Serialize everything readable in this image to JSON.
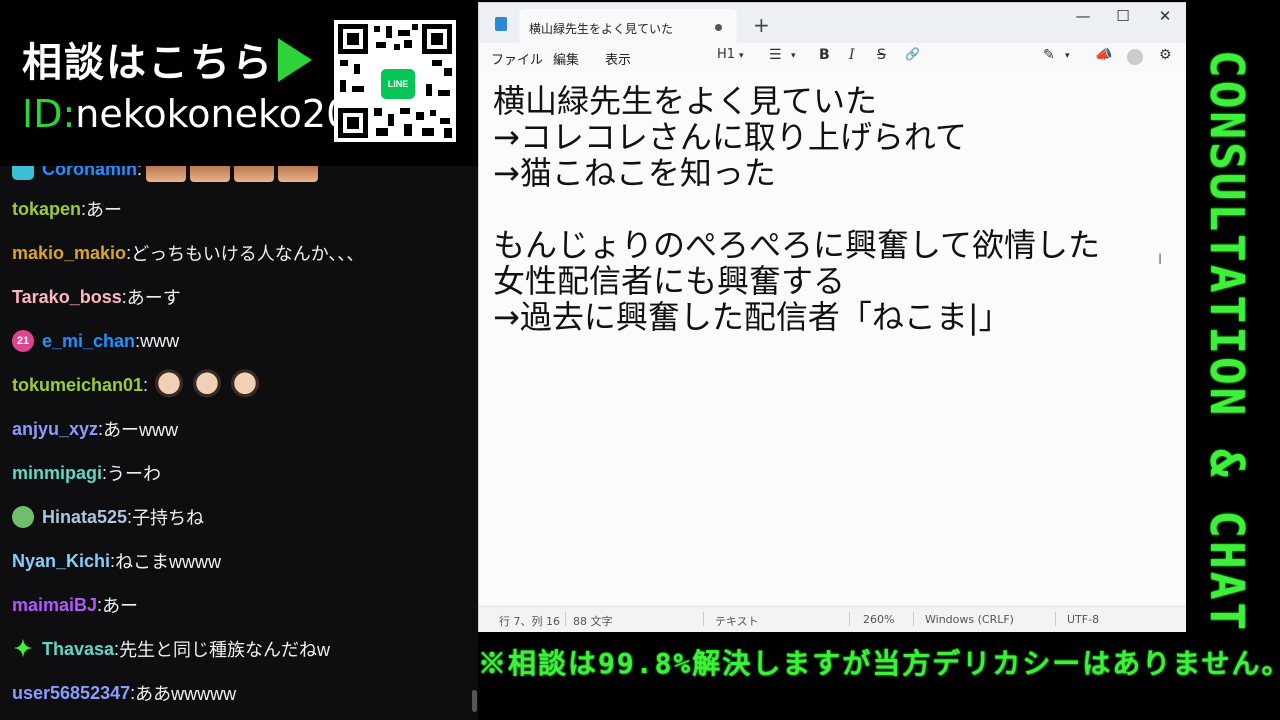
{
  "header": {
    "title": "相談はこちら",
    "id_prefix": "ID:",
    "id_value": "nekokoneko2018",
    "line_logo": "LINE"
  },
  "chat": {
    "messages": [
      {
        "user": "Coronamin",
        "color": "#1e90ff",
        "text": "",
        "badge": "shield",
        "emotes": [
          "brown",
          "brown",
          "brown",
          "brown"
        ]
      },
      {
        "user": "tokapen",
        "color": "#9acd32",
        "text": "あー",
        "badge": "",
        "emotes": []
      },
      {
        "user": "makio_makio",
        "color": "#daa520",
        "text": "どっちもいける人なんか､､､",
        "badge": "",
        "emotes": []
      },
      {
        "user": "Tarako_boss",
        "color": "#ffb6c1",
        "text": "あーす",
        "badge": "",
        "emotes": []
      },
      {
        "user": "e_mi_chan",
        "color": "#1e90ff",
        "text": "www",
        "badge": "21",
        "emotes": []
      },
      {
        "user": "tokumeichan01",
        "color": "#9acd32",
        "text": "",
        "badge": "",
        "emotes": [
          "face",
          "face",
          "face"
        ]
      },
      {
        "user": "anjyu_xyz",
        "color": "#8a9cff",
        "text": "あーwww",
        "badge": "",
        "emotes": []
      },
      {
        "user": "minmipagi",
        "color": "#5fd7c6",
        "text": "うーわ",
        "badge": "",
        "emotes": []
      },
      {
        "user": "Hinata525",
        "color": "#b0c4de",
        "text": "子持ちね",
        "badge": "alien",
        "emotes": []
      },
      {
        "user": "Nyan_Kichi",
        "color": "#87cefa",
        "text": "ねこまwwww",
        "badge": "",
        "emotes": []
      },
      {
        "user": "maimaiBJ",
        "color": "#b455ff",
        "text": "あー",
        "badge": "",
        "emotes": []
      },
      {
        "user": "Thavasa",
        "color": "#5fd7c6",
        "text": "先生と同じ種族なんだねw",
        "badge": "star",
        "emotes": []
      },
      {
        "user": "user56852347",
        "color": "#8a9cff",
        "text": "ああwwwww",
        "badge": "",
        "emotes": []
      }
    ]
  },
  "window": {
    "tab_title": "横山緑先生をよく見ていた",
    "new_tab": "+",
    "minimize": "—",
    "maximize": "☐",
    "close": "✕",
    "menu": {
      "file": "ファイル",
      "edit": "編集",
      "view": "表示"
    },
    "toolbar": {
      "heading": "H1",
      "list": "☰",
      "bold": "B",
      "italic": "I",
      "strike": "S",
      "link": "🔗"
    },
    "content": "横山緑先生をよく見ていた\n→コレコレさんに取り上げられて\n→猫こねこを知った\n\nもんじょりのぺろぺろに興奮して欲情した\n女性配信者にも興奮する\n→過去に興奮した配信者「ねこま|」",
    "status": {
      "position": "行 7、列 16",
      "chars": "88 文字",
      "format": "テキスト",
      "zoom": "260%",
      "line_ending": "Windows (CRLF)",
      "encoding": "UTF-8"
    }
  },
  "banner": {
    "vertical": "CONSULTATION & CHAT",
    "ticker": "※相談は99.8%解決しますが当方デリカシーはありません。"
  }
}
